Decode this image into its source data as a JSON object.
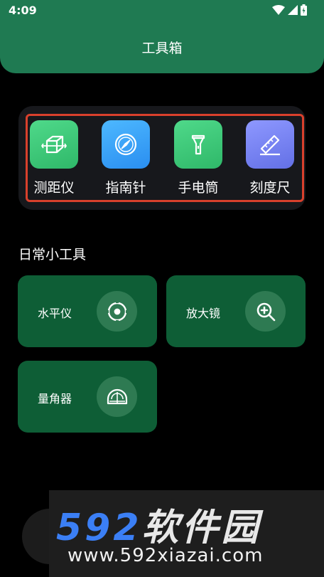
{
  "status_bar": {
    "time": "4:09"
  },
  "header": {
    "title": "工具箱"
  },
  "tools": [
    {
      "label": "测距仪",
      "icon": "cube-measure-icon",
      "color": "#3fcb7c"
    },
    {
      "label": "指南针",
      "icon": "compass-icon",
      "color": "#3aa6f5"
    },
    {
      "label": "手电筒",
      "icon": "flashlight-icon",
      "color": "#35c774"
    },
    {
      "label": "刻度尺",
      "icon": "ruler-icon",
      "color": "#7a85f0"
    }
  ],
  "daily": {
    "title": "日常小工具",
    "items": [
      {
        "label": "水平仪",
        "icon": "level-icon"
      },
      {
        "label": "放大镜",
        "icon": "magnifier-icon"
      },
      {
        "label": "量角器",
        "icon": "protractor-icon"
      }
    ]
  },
  "watermark": {
    "brand_num": "592",
    "brand_cn": "软件园",
    "url": "www.592xiazai.com"
  },
  "colors": {
    "header": "#1f7a52",
    "card": "#0e5e36",
    "highlight": "#d9402c"
  }
}
